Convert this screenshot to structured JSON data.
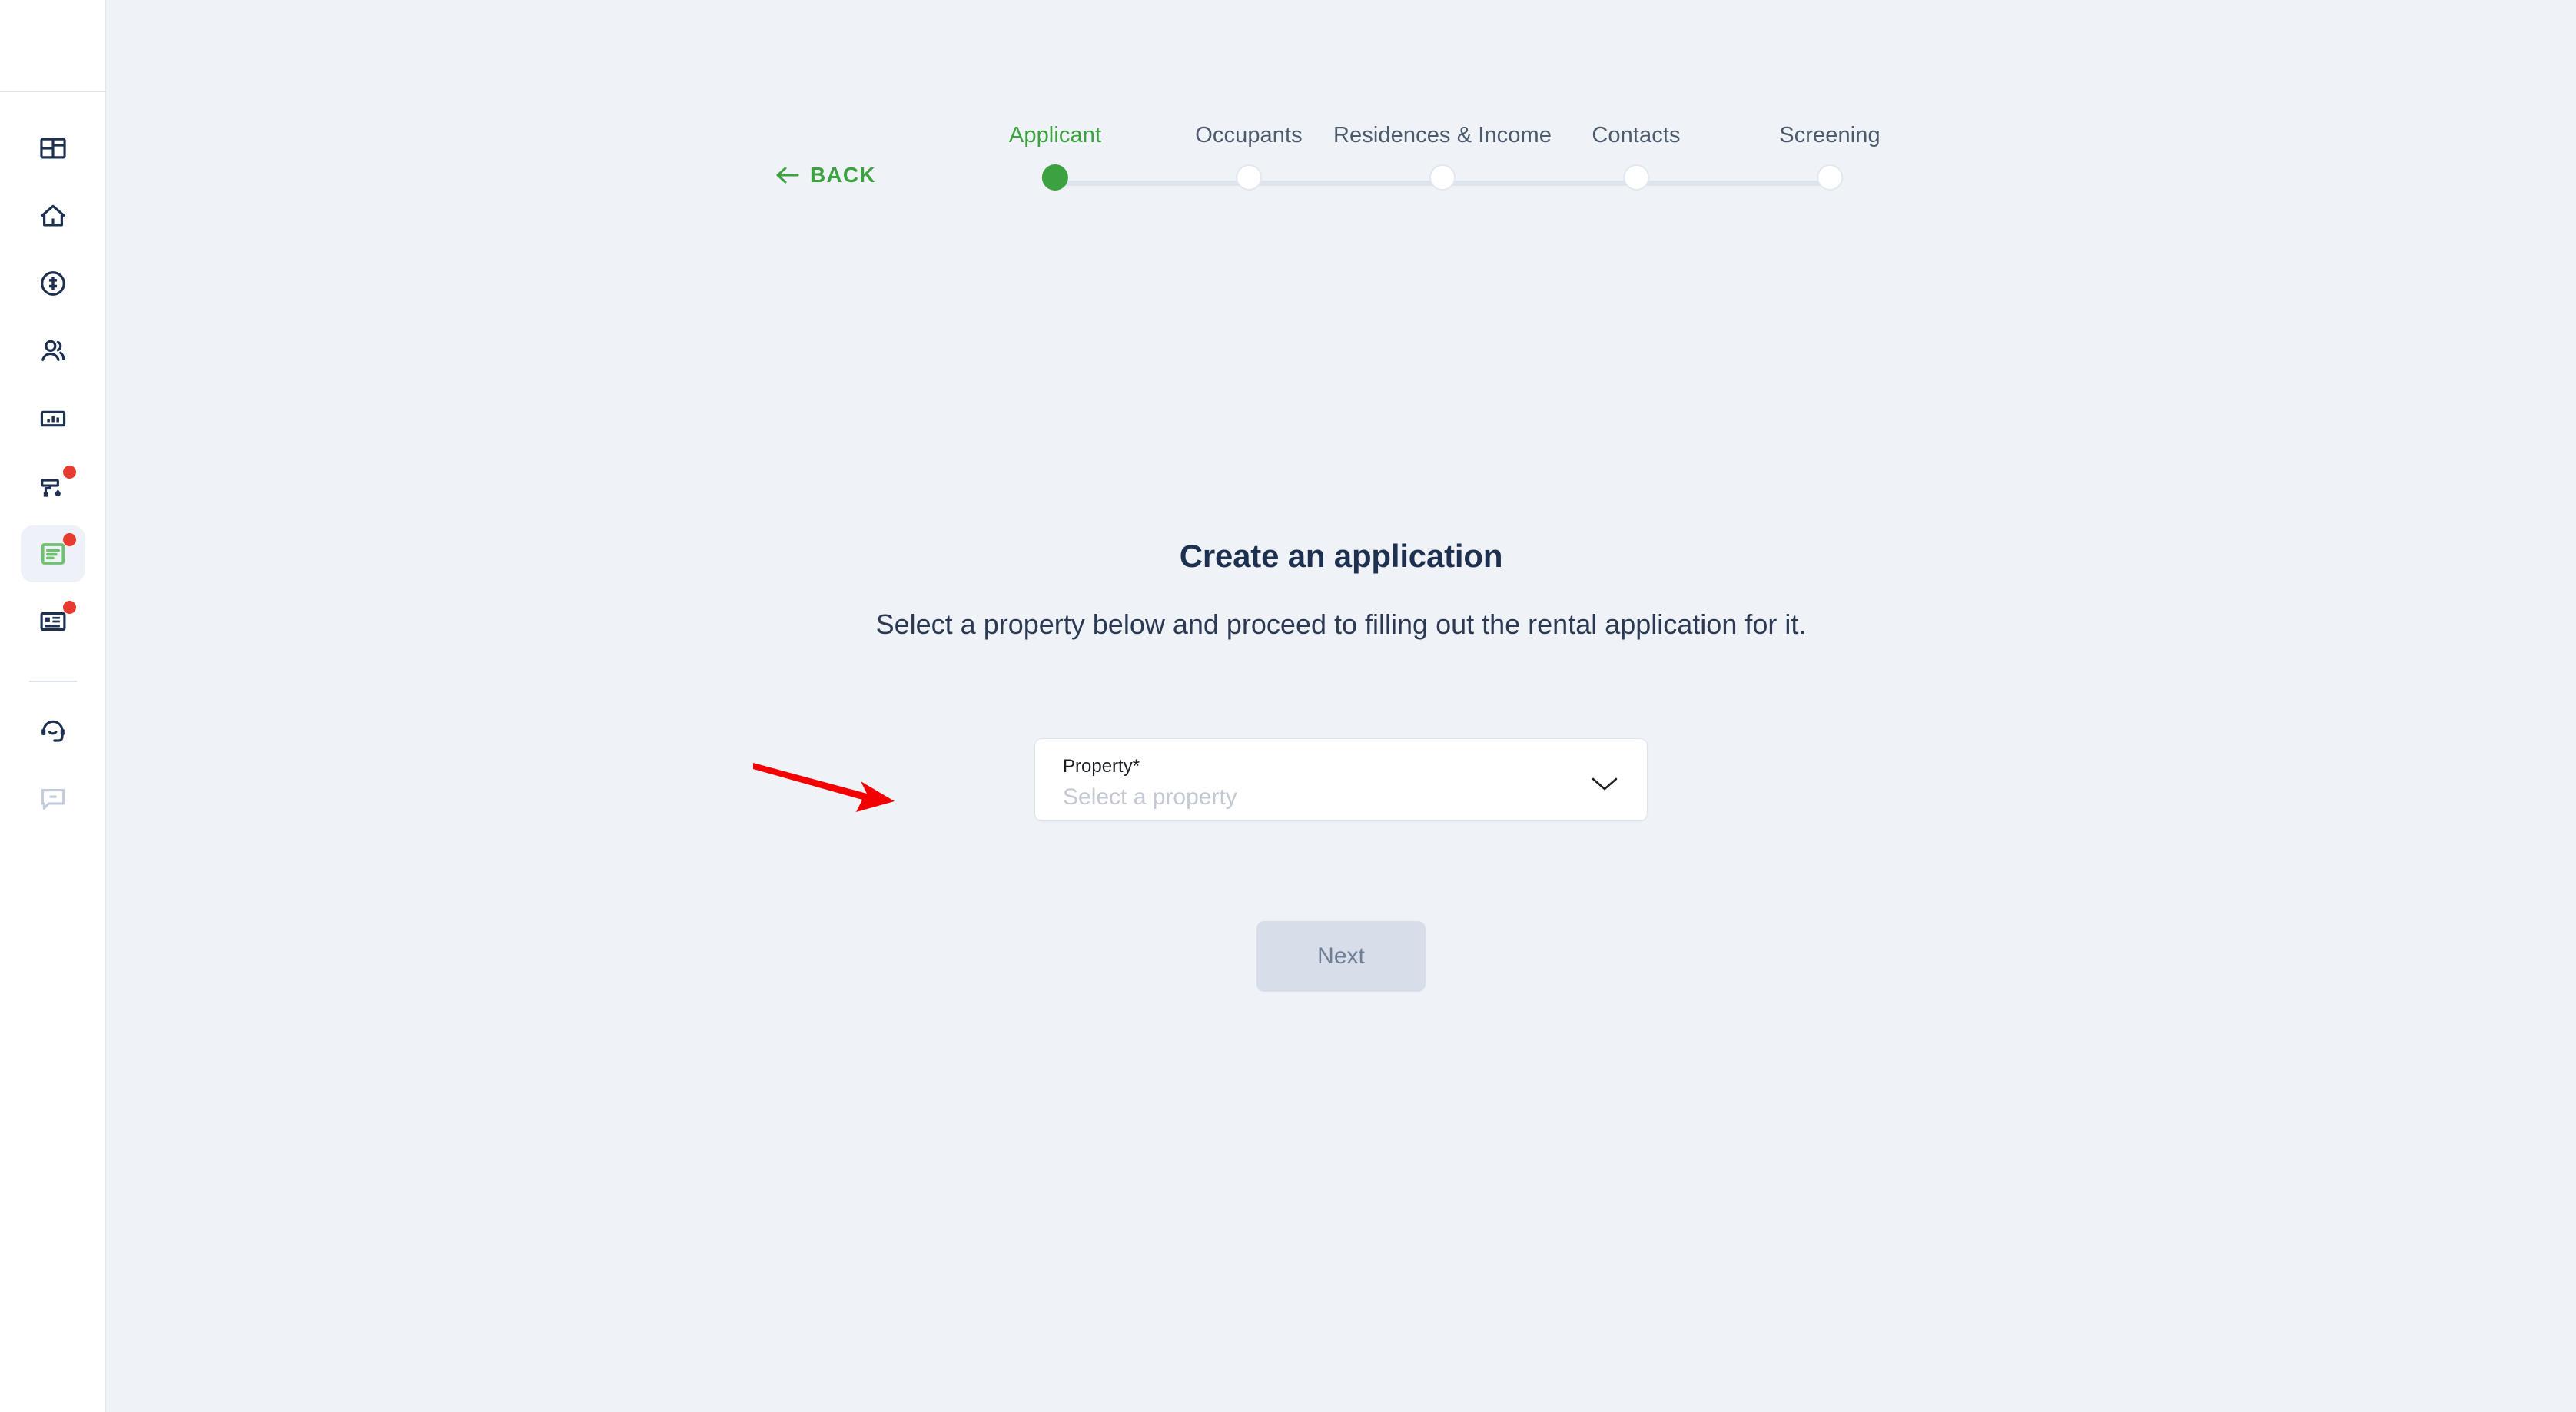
{
  "colors": {
    "accent_green": "#3ba23f",
    "page_background": "#eff2f7",
    "sidebar_background": "#ffffff",
    "heading": "#1d3050",
    "badge_red": "#e63b2e",
    "next_button_bg": "#d7dee9",
    "next_button_text": "#6e7e95",
    "annotation_arrow": "#f40000",
    "step_track": "#dde4ed"
  },
  "sidebar": {
    "items": [
      {
        "icon": "dashboard-grid-icon",
        "active": false,
        "badge": false
      },
      {
        "icon": "home-icon",
        "active": false,
        "badge": false
      },
      {
        "icon": "dollar-circle-icon",
        "active": false,
        "badge": false
      },
      {
        "icon": "people-icon",
        "active": false,
        "badge": false
      },
      {
        "icon": "bar-chart-icon",
        "active": false,
        "badge": false
      },
      {
        "icon": "paint-roller-icon",
        "active": false,
        "badge": true
      },
      {
        "icon": "document-lines-icon",
        "active": true,
        "badge": true
      },
      {
        "icon": "id-card-icon",
        "active": false,
        "badge": true
      }
    ],
    "footer_items": [
      {
        "icon": "headset-support-icon",
        "active": false,
        "badge": false
      },
      {
        "icon": "chat-bubble-icon",
        "active": false,
        "badge": false
      }
    ]
  },
  "header": {
    "back_label": "BACK",
    "back_icon": "arrow-left-icon"
  },
  "stepper": {
    "current_index": 0,
    "steps": [
      {
        "label": "Applicant"
      },
      {
        "label": "Occupants"
      },
      {
        "label": "Residences & Income"
      },
      {
        "label": "Contacts"
      },
      {
        "label": "Screening"
      }
    ]
  },
  "main": {
    "title": "Create an application",
    "subtitle": "Select a property below and proceed to filling out the rental application for it.",
    "property_field": {
      "label": "Property*",
      "placeholder": "Select a property",
      "value": "",
      "chevron_icon": "chevron-down-icon"
    },
    "next_label": "Next"
  },
  "annotation": {
    "type": "red-arrow",
    "points_to": "property-select"
  }
}
